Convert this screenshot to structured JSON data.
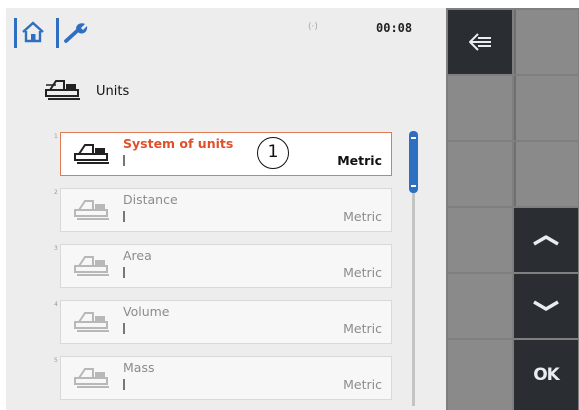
{
  "status": {
    "signal": "(·)",
    "time": "00:08"
  },
  "header": {
    "title": "Units"
  },
  "settings": [
    {
      "index": "1",
      "label": "System of units",
      "value": "Metric",
      "selected": true
    },
    {
      "index": "2",
      "label": "Distance",
      "value": "Metric",
      "selected": false
    },
    {
      "index": "3",
      "label": "Area",
      "value": "Metric",
      "selected": false
    },
    {
      "index": "4",
      "label": "Volume",
      "value": "Metric",
      "selected": false
    },
    {
      "index": "5",
      "label": "Mass",
      "value": "Metric",
      "selected": false
    }
  ],
  "annotation": {
    "callout": "1"
  },
  "softkeys": {
    "ok_label": "OK"
  },
  "icons": {
    "home": "home-icon",
    "wrench": "wrench-icon",
    "units": "units-settings-icon",
    "back": "back-arrow-icon",
    "up": "chevron-up-icon",
    "down": "chevron-down-icon"
  },
  "colors": {
    "accent": "#2f6fc2",
    "selected_label": "#e0512a",
    "selected_border": "#e07a52",
    "panel": "#ededed",
    "key": "#8a8a8a",
    "key_active": "#2a2d31"
  }
}
